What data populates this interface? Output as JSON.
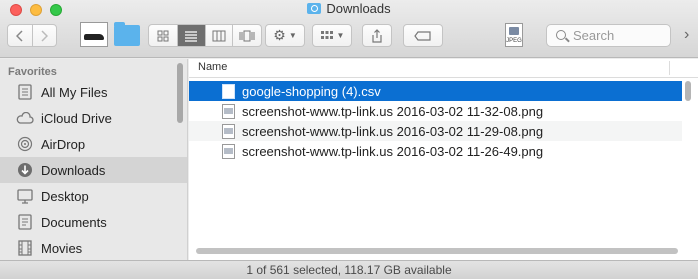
{
  "window": {
    "title": "Downloads"
  },
  "toolbar": {
    "thumb_label": "JPEG",
    "search_placeholder": "Search"
  },
  "sidebar": {
    "heading": "Favorites",
    "items": [
      {
        "label": "All My Files",
        "icon": "all-files-icon"
      },
      {
        "label": "iCloud Drive",
        "icon": "cloud-icon"
      },
      {
        "label": "AirDrop",
        "icon": "airdrop-icon"
      },
      {
        "label": "Downloads",
        "icon": "download-icon",
        "selected": true
      },
      {
        "label": "Desktop",
        "icon": "desktop-icon"
      },
      {
        "label": "Documents",
        "icon": "documents-icon"
      },
      {
        "label": "Movies",
        "icon": "movies-icon"
      }
    ]
  },
  "files": {
    "column_name": "Name",
    "rows": [
      {
        "name": "google-shopping (4).csv",
        "selected": true,
        "icon": "document-icon"
      },
      {
        "name": "screenshot-www.tp-link.us 2016-03-02 11-32-08.png",
        "icon": "image-file-icon"
      },
      {
        "name": "screenshot-www.tp-link.us 2016-03-02 11-29-08.png",
        "icon": "image-file-icon"
      },
      {
        "name": "screenshot-www.tp-link.us 2016-03-02 11-26-49.png",
        "icon": "image-file-icon"
      }
    ]
  },
  "status": {
    "text": "1 of 561 selected, 118.17 GB available"
  },
  "colors": {
    "selection": "#0b6fd2",
    "folder": "#5bb3ec"
  }
}
